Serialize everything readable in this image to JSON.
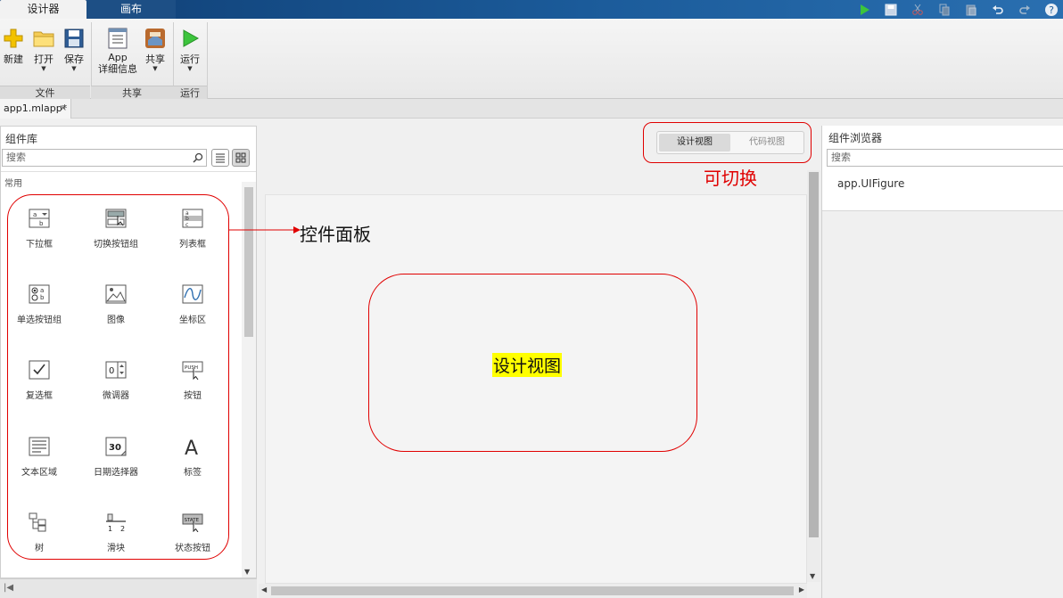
{
  "top_tabs": {
    "designer": "设计器",
    "canvas": "画布"
  },
  "quick_access": [
    "run-icon",
    "save-icon",
    "cut-icon",
    "copy-icon",
    "paste-icon",
    "undo-icon",
    "redo-icon",
    "help-icon"
  ],
  "toolstrip": {
    "new": "新建",
    "open": "打开",
    "save": "保存",
    "app_details_line1": "App",
    "app_details_line2": "详细信息",
    "share": "共享",
    "run": "运行",
    "sections": {
      "file": "文件",
      "share": "共享",
      "run": "运行"
    }
  },
  "document_tab": {
    "name": "app1.mlapp*",
    "close": "×"
  },
  "library": {
    "title": "组件库",
    "search_placeholder": "搜索",
    "category": "常用",
    "components": [
      "下拉框",
      "切换按钮组",
      "列表框",
      "单选按钮组",
      "图像",
      "坐标区",
      "复选框",
      "微调器",
      "按钮",
      "文本区域",
      "日期选择器",
      "标签",
      "树",
      "滑块",
      "状态按钮"
    ]
  },
  "view_toggle": {
    "design": "设计视图",
    "code": "代码视图"
  },
  "browser": {
    "title": "组件浏览器",
    "search_placeholder": "搜索",
    "item": "app.UIFigure"
  },
  "annotations": {
    "toggle": "可切换",
    "panel": "控件面板",
    "design_view": "设计视图"
  },
  "colors": {
    "annotation_red": "#e00000",
    "highlight_yellow": "#ffff00",
    "title_bar": "#1b5b9a"
  }
}
